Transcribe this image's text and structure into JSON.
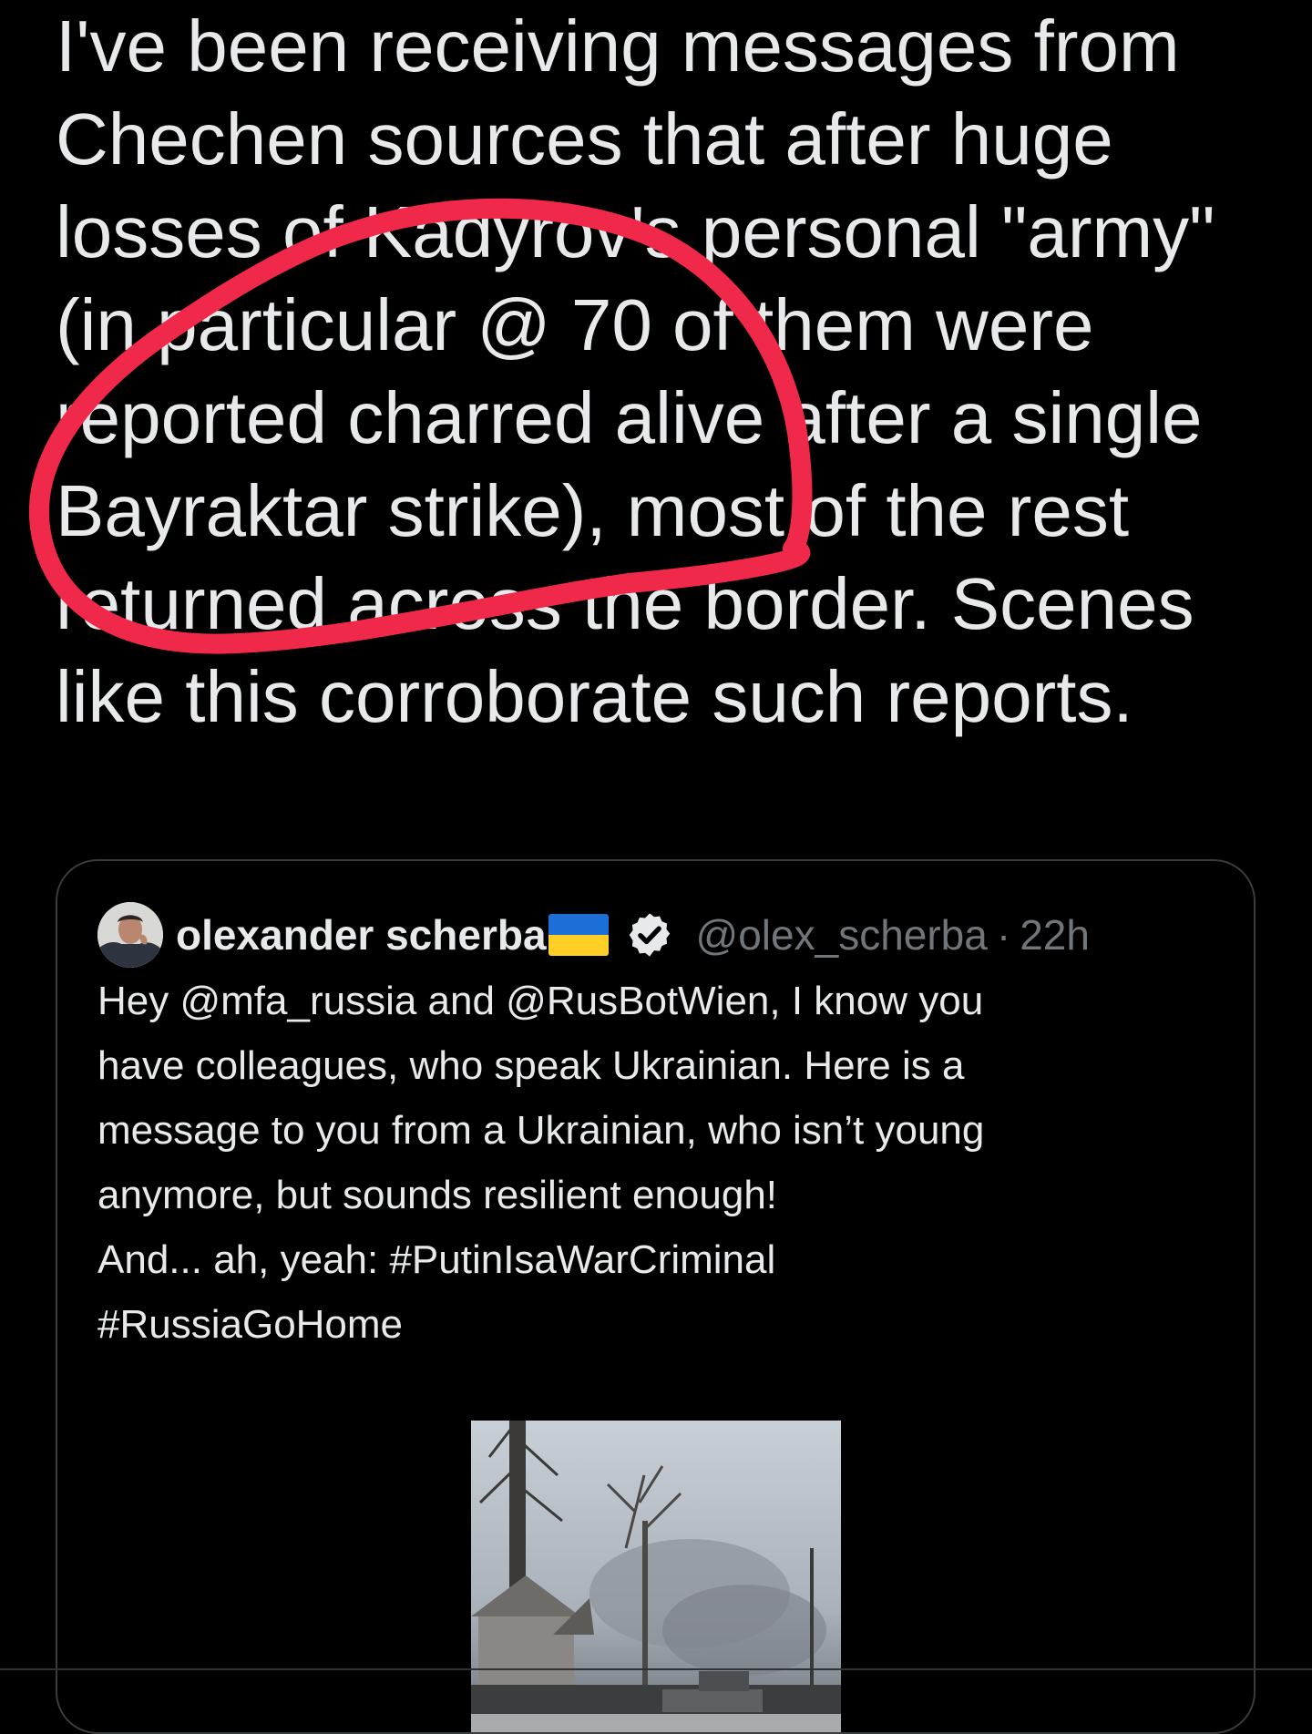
{
  "tweet": {
    "text": "I've been receiving messages from Chechen sources that after huge losses of Kadyrov's personal \"army\" (in particular @ 70 of them were reported charred alive after a single Bayraktar strike), most of the rest returned across the border. Scenes like this corroborate such reports."
  },
  "quoted_tweet": {
    "display_name": "olexander scherba",
    "handle": "@olex_scherba",
    "separator": "·",
    "time": "22h",
    "body_lines": [
      "Hey @mfa_russia and @RusBotWien, I know you",
      "have colleagues, who speak Ukrainian. Here is a",
      "message to you from a Ukrainian, who isn’t young",
      "anymore, but sounds resilient enough!",
      "And... ah, yeah: #PutinIsaWarCriminal",
      "#RussiaGoHome"
    ],
    "flag_icon": "ukraine-flag-icon",
    "verified_icon": "verified-badge-icon"
  },
  "colors": {
    "background": "#000000",
    "text": "#e7e9ea",
    "muted": "#71767b",
    "border": "#3a3d40",
    "annotation": "#f0294a"
  }
}
